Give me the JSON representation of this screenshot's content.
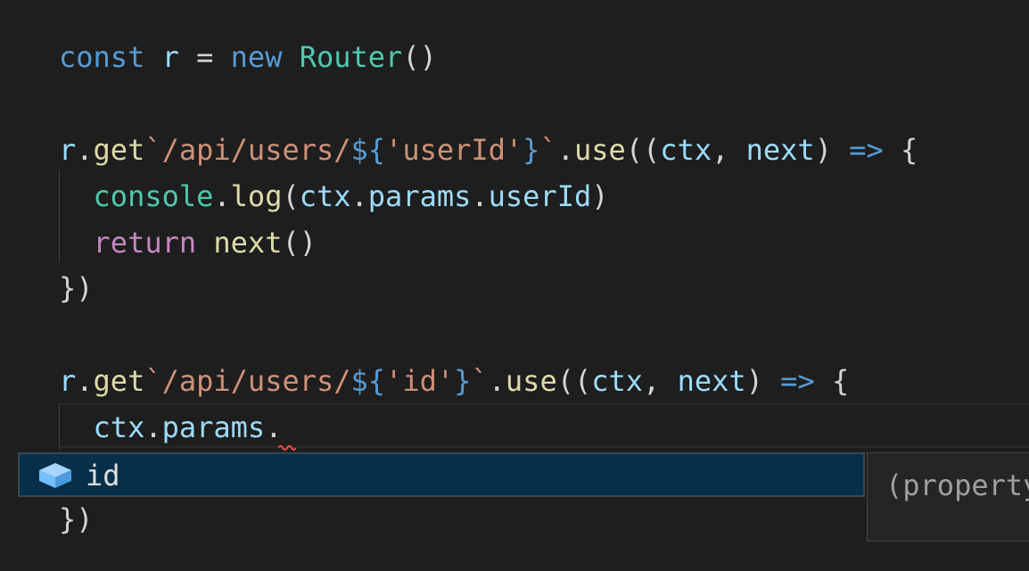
{
  "editor": {
    "lines": [
      {
        "tokens": [
          {
            "text": "const",
            "cls": "kw-blue"
          },
          {
            "text": " ",
            "cls": "punc"
          },
          {
            "text": "r",
            "cls": "var"
          },
          {
            "text": " = ",
            "cls": "punc"
          },
          {
            "text": "new",
            "cls": "kw-blue"
          },
          {
            "text": " ",
            "cls": "punc"
          },
          {
            "text": "Router",
            "cls": "cls"
          },
          {
            "text": "()",
            "cls": "punc"
          }
        ]
      },
      {
        "tokens": []
      },
      {
        "tokens": [
          {
            "text": "r",
            "cls": "var"
          },
          {
            "text": ".",
            "cls": "punc"
          },
          {
            "text": "get",
            "cls": "fn"
          },
          {
            "text": "`/api/users/",
            "cls": "str"
          },
          {
            "text": "${",
            "cls": "tmpl"
          },
          {
            "text": "'userId'",
            "cls": "str"
          },
          {
            "text": "}",
            "cls": "tmpl"
          },
          {
            "text": "`",
            "cls": "str"
          },
          {
            "text": ".",
            "cls": "punc"
          },
          {
            "text": "use",
            "cls": "fn"
          },
          {
            "text": "((",
            "cls": "punc"
          },
          {
            "text": "ctx",
            "cls": "var"
          },
          {
            "text": ", ",
            "cls": "punc"
          },
          {
            "text": "next",
            "cls": "var"
          },
          {
            "text": ") ",
            "cls": "punc"
          },
          {
            "text": "=>",
            "cls": "kw-blue"
          },
          {
            "text": " {",
            "cls": "punc"
          }
        ]
      },
      {
        "tokens": [
          {
            "text": "  ",
            "cls": "punc"
          },
          {
            "text": "console",
            "cls": "cls"
          },
          {
            "text": ".",
            "cls": "punc"
          },
          {
            "text": "log",
            "cls": "fn"
          },
          {
            "text": "(",
            "cls": "punc"
          },
          {
            "text": "ctx",
            "cls": "var"
          },
          {
            "text": ".",
            "cls": "punc"
          },
          {
            "text": "params",
            "cls": "var"
          },
          {
            "text": ".",
            "cls": "punc"
          },
          {
            "text": "userId",
            "cls": "var"
          },
          {
            "text": ")",
            "cls": "punc"
          }
        ]
      },
      {
        "tokens": [
          {
            "text": "  ",
            "cls": "punc"
          },
          {
            "text": "return",
            "cls": "kw-purple"
          },
          {
            "text": " ",
            "cls": "punc"
          },
          {
            "text": "next",
            "cls": "fn"
          },
          {
            "text": "()",
            "cls": "punc"
          }
        ]
      },
      {
        "tokens": [
          {
            "text": "})",
            "cls": "punc"
          }
        ]
      },
      {
        "tokens": []
      },
      {
        "tokens": [
          {
            "text": "r",
            "cls": "var"
          },
          {
            "text": ".",
            "cls": "punc"
          },
          {
            "text": "get",
            "cls": "fn"
          },
          {
            "text": "`/api/users/",
            "cls": "str"
          },
          {
            "text": "${",
            "cls": "tmpl"
          },
          {
            "text": "'id'",
            "cls": "str"
          },
          {
            "text": "}",
            "cls": "tmpl"
          },
          {
            "text": "`",
            "cls": "str"
          },
          {
            "text": ".",
            "cls": "punc"
          },
          {
            "text": "use",
            "cls": "fn"
          },
          {
            "text": "((",
            "cls": "punc"
          },
          {
            "text": "ctx",
            "cls": "var"
          },
          {
            "text": ", ",
            "cls": "punc"
          },
          {
            "text": "next",
            "cls": "var"
          },
          {
            "text": ") ",
            "cls": "punc"
          },
          {
            "text": "=>",
            "cls": "kw-blue"
          },
          {
            "text": " {",
            "cls": "punc"
          }
        ]
      },
      {
        "tokens": [
          {
            "text": "  ",
            "cls": "punc"
          },
          {
            "text": "ctx",
            "cls": "var"
          },
          {
            "text": ".",
            "cls": "punc"
          },
          {
            "text": "params",
            "cls": "var"
          },
          {
            "text": ".",
            "cls": "punc"
          }
        ]
      },
      {
        "tokens": []
      },
      {
        "tokens": [
          {
            "text": "})",
            "cls": "punc"
          }
        ]
      }
    ]
  },
  "suggest": {
    "icon": "property-cube-icon",
    "items": [
      {
        "label": "id",
        "selected": true
      }
    ]
  },
  "details": {
    "text": "(property) id: string"
  },
  "colors": {
    "background": "#1e1e1e",
    "keyword": "#569cd6",
    "control_keyword": "#c586c0",
    "type": "#4ec9b0",
    "function": "#dcdcaa",
    "variable": "#9cdcfe",
    "string": "#ce9178",
    "suggest_selected": "#062f4a",
    "icon_blue": "#75beff",
    "squiggle": "#f14c4c"
  }
}
